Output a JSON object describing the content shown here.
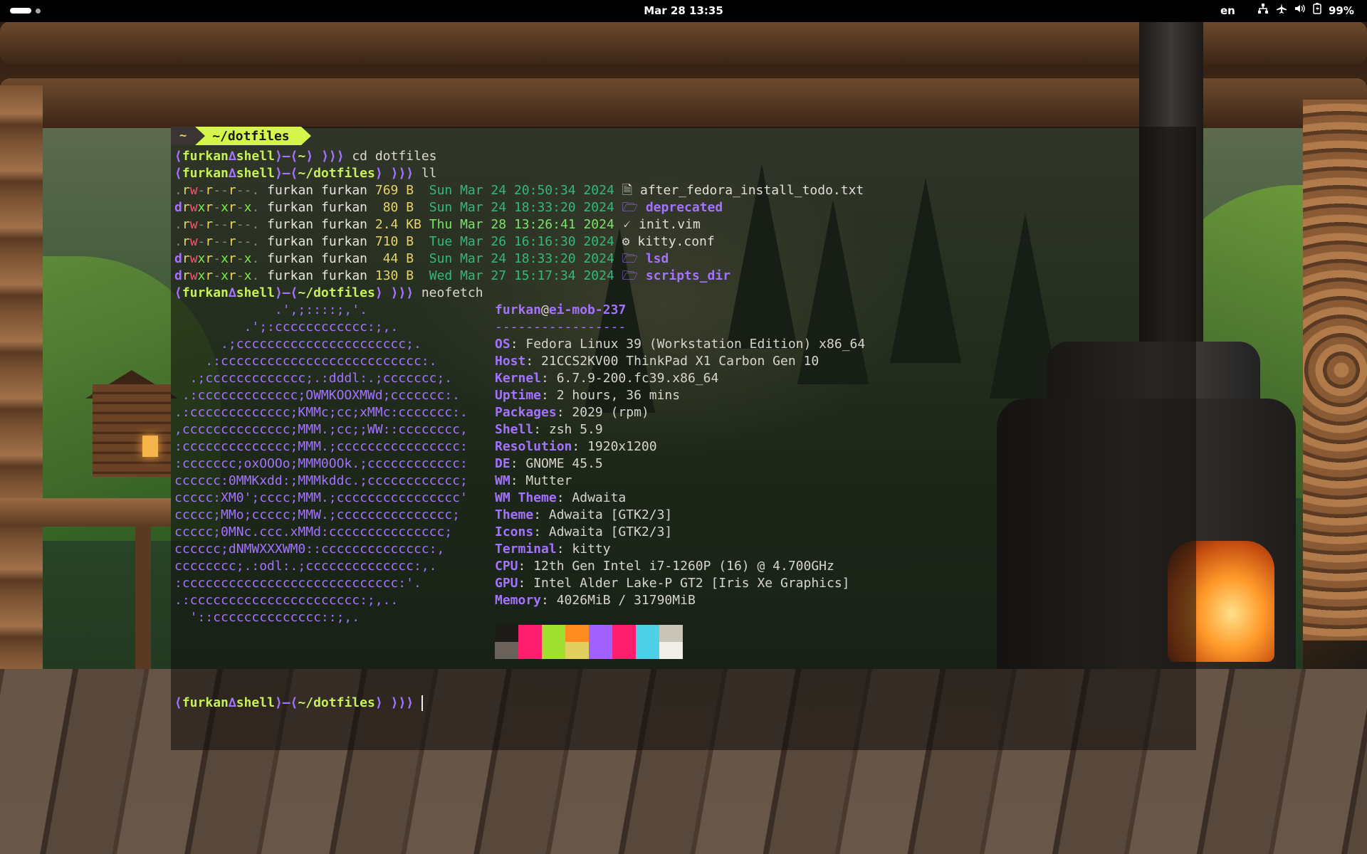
{
  "topbar": {
    "clock": "Mar 28  13:35",
    "language": "en",
    "battery_percent": "99%",
    "icons": [
      "network-icon",
      "airplane-mode-icon",
      "volume-icon",
      "battery-icon"
    ]
  },
  "terminal": {
    "tabs": [
      {
        "label": "~"
      },
      {
        "label": "~/dotfiles"
      }
    ],
    "prompt": {
      "user": "furkan",
      "delta": "∆",
      "host": "shell",
      "dash": "⟩—⟨",
      "open": "⟨",
      "close": "⟩",
      "arrows": "⟩⟩⟩"
    },
    "commands": [
      {
        "path": "~",
        "cmd": "cd dotfiles"
      },
      {
        "path": "~/dotfiles",
        "cmd": "ll"
      },
      {
        "path": "~/dotfiles",
        "cmd": "neofetch"
      },
      {
        "path": "~/dotfiles",
        "cmd": ""
      }
    ],
    "listing": [
      {
        "type": ".",
        "perms": "rw-r--r--.",
        "owner": "furkan furkan",
        "size": "769 B ",
        "date": "Sun Mar 24 20:50:34 2024",
        "recent": false,
        "icon": "🗎",
        "name": "after_fedora_install_todo.txt",
        "dir": false
      },
      {
        "type": "d",
        "perms": "rwxr-xr-x.",
        "owner": "furkan furkan",
        "size": " 80 B ",
        "date": "Sun Mar 24 18:33:20 2024",
        "recent": false,
        "icon": "🗁",
        "name": "deprecated",
        "dir": true
      },
      {
        "type": ".",
        "perms": "rw-r--r--.",
        "owner": "furkan furkan",
        "size": "2.4 KB",
        "date": "Thu Mar 28 13:26:41 2024",
        "recent": true,
        "icon": "🗸",
        "name": "init.vim",
        "dir": false
      },
      {
        "type": ".",
        "perms": "rw-r--r--.",
        "owner": "furkan furkan",
        "size": "710 B ",
        "date": "Tue Mar 26 16:16:30 2024",
        "recent": false,
        "icon": "⚙",
        "name": "kitty.conf",
        "dir": false
      },
      {
        "type": "d",
        "perms": "rwxr-xr-x.",
        "owner": "furkan furkan",
        "size": " 44 B ",
        "date": "Sun Mar 24 18:33:20 2024",
        "recent": false,
        "icon": "🗁",
        "name": "lsd",
        "dir": true
      },
      {
        "type": "d",
        "perms": "rwxr-xr-x.",
        "owner": "furkan furkan",
        "size": "130 B ",
        "date": "Wed Mar 27 15:17:34 2024",
        "recent": false,
        "icon": "🗁",
        "name": "scripts_dir",
        "dir": true
      }
    ],
    "neofetch": {
      "user": "furkan",
      "at": "@",
      "host": "ei-mob-237",
      "separator": "-----------------",
      "fields": [
        {
          "key": "OS",
          "value": "Fedora Linux 39 (Workstation Edition) x86_64"
        },
        {
          "key": "Host",
          "value": "21CCS2KV00 ThinkPad X1 Carbon Gen 10"
        },
        {
          "key": "Kernel",
          "value": "6.7.9-200.fc39.x86_64"
        },
        {
          "key": "Uptime",
          "value": "2 hours, 36 mins"
        },
        {
          "key": "Packages",
          "value": "2029 (rpm)"
        },
        {
          "key": "Shell",
          "value": "zsh 5.9"
        },
        {
          "key": "Resolution",
          "value": "1920x1200"
        },
        {
          "key": "DE",
          "value": "GNOME 45.5"
        },
        {
          "key": "WM",
          "value": "Mutter"
        },
        {
          "key": "WM Theme",
          "value": "Adwaita"
        },
        {
          "key": "Theme",
          "value": "Adwaita [GTK2/3]"
        },
        {
          "key": "Icons",
          "value": "Adwaita [GTK2/3]"
        },
        {
          "key": "Terminal",
          "value": "kitty"
        },
        {
          "key": "CPU",
          "value": "12th Gen Intel i7-1260P (16) @ 4.700GHz"
        },
        {
          "key": "GPU",
          "value": "Intel Alder Lake-P GT2 [Iris Xe Graphics]"
        },
        {
          "key": "Memory",
          "value": "4026MiB / 31790MiB"
        }
      ],
      "logo": [
        "             .',;::::;,'.",
        "         .';:cccccccccccc:;,.",
        "      .;cccccccccccccccccccccc;.",
        "    .:cccccccccccccccccccccccccc:.",
        "  .;ccccccccccccc;.:dddl:.;ccccccc;.",
        " .:ccccccccccccc;OWMKOOXMWd;ccccccc:.",
        ".:ccccccccccccc;KMMc;cc;xMMc:ccccccc:.",
        ",cccccccccccccc;MMM.;cc;;WW::cccccccc,",
        ":cccccccccccccc;MMM.;cccccccccccccccc:",
        ":ccccccc;oxOOOo;MMM0OOk.;cccccccccccc:",
        "cccccc:0MMKxdd:;MMMkddc.;cccccccccccc;",
        "ccccc:XM0';cccc;MMM.;cccccccccccccccc'",
        "ccccc;MMo;ccccc;MMW.;ccccccccccccccc;",
        "ccccc;0MNc.ccc.xMMd:ccccccccccccccc;",
        "cccccc;dNMWXXXWM0::cccccccccccccc:,",
        "cccccccc;.:odl:.;cccccccccccccc:,.",
        ":cccccccccccccccccccccccccccc:'.",
        ".:cccccccccccccccccccccc:;,..",
        "  '::cccccccccccccc::;,."
      ],
      "palette_top": [
        "#1e1a17",
        "#ff1e6e",
        "#a0e030",
        "#ff8c1e",
        "#a061ff",
        "#ff1e6e",
        "#4dd0e8",
        "#c8c4b8"
      ],
      "palette_bottom": [
        "#6a625a",
        "#ff1e6e",
        "#a0e030",
        "#e0d060",
        "#a061ff",
        "#ff1e6e",
        "#4dd0e8",
        "#f2efe9"
      ]
    }
  }
}
